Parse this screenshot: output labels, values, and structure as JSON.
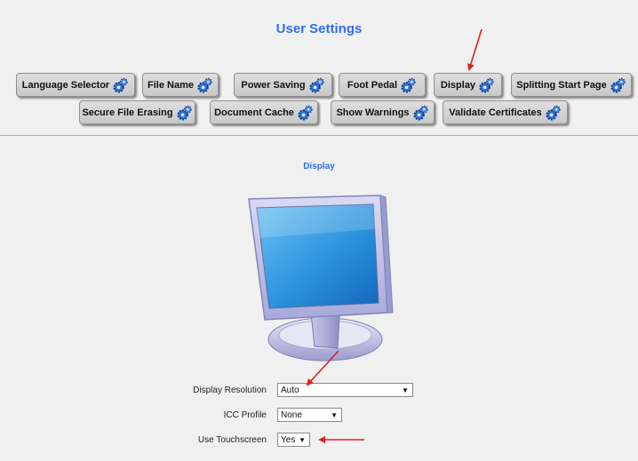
{
  "header": {
    "title": "User Settings"
  },
  "buttons": [
    {
      "label": "Language Selector"
    },
    {
      "label": "File Name"
    },
    {
      "label": "Power Saving"
    },
    {
      "label": "Foot Pedal"
    },
    {
      "label": "Display"
    },
    {
      "label": "Splitting Start Page"
    },
    {
      "label": "Secure File Erasing"
    },
    {
      "label": "Document Cache"
    },
    {
      "label": "Show Warnings"
    },
    {
      "label": "Validate Certificates"
    }
  ],
  "icons": {
    "button_icon": "gear-icon",
    "illustration": "monitor-icon"
  },
  "section": {
    "title": "Display"
  },
  "form": {
    "display_resolution": {
      "label": "Display Resolution",
      "value": "Auto"
    },
    "icc_profile": {
      "label": "ICC Profile",
      "value": "None"
    },
    "use_touchscreen": {
      "label": "Use Touchscreen",
      "value": "Yes"
    }
  },
  "colors": {
    "accent": "#2e6ff2",
    "annotation_arrow": "#e02020"
  }
}
